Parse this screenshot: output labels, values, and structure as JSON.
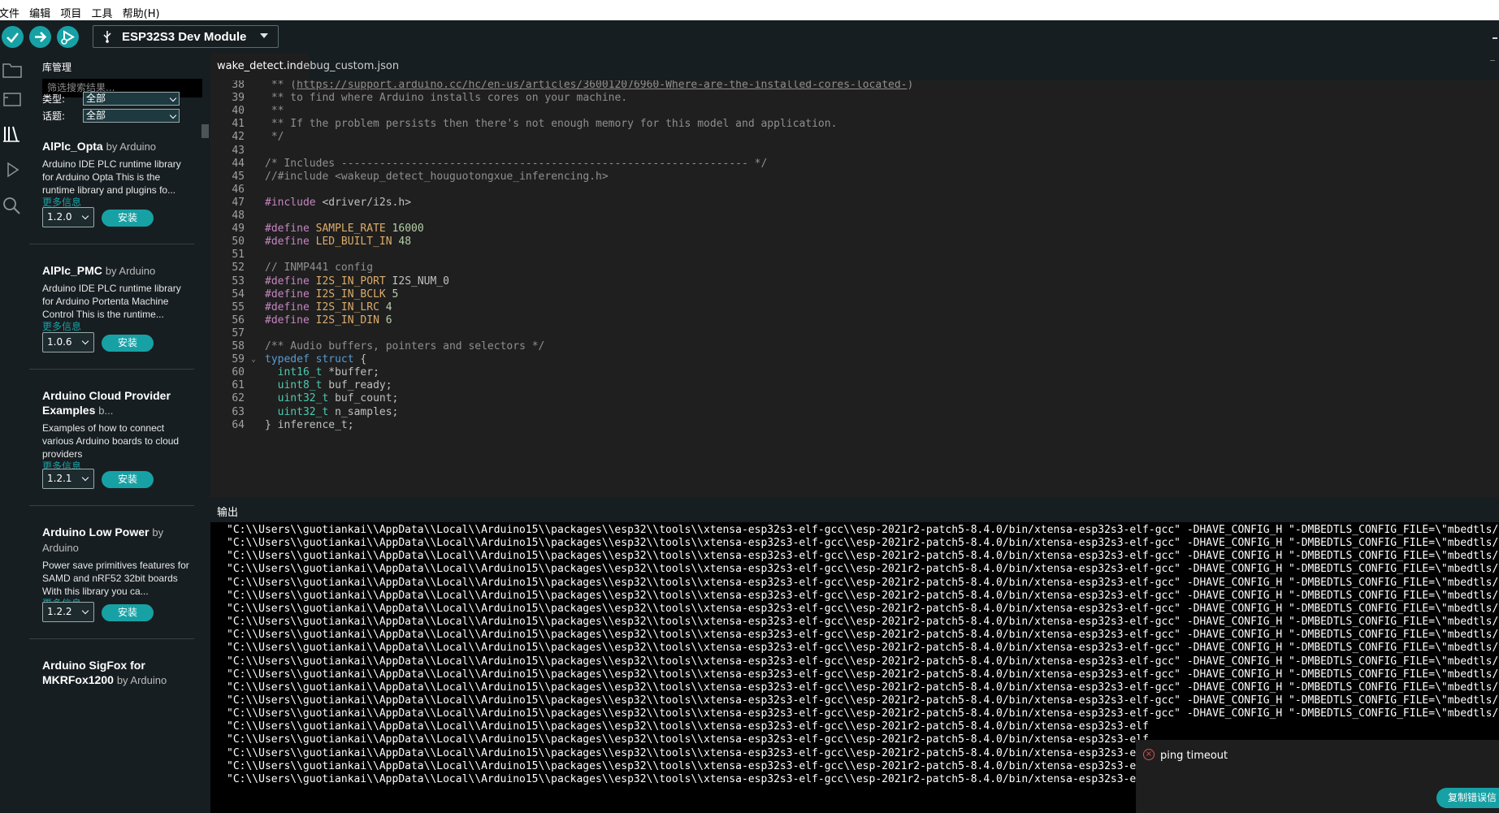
{
  "menubar": [
    "文件",
    "编辑",
    "项目",
    "工具",
    "帮助(H)"
  ],
  "toolbar": {
    "board_label": "ESP32S3 Dev Module",
    "accent": "#17a1a5"
  },
  "library_manager": {
    "title": "库管理",
    "search_placeholder": "筛选搜索结果...",
    "type_label": "类型:",
    "type_value": "全部",
    "topic_label": "话题:",
    "topic_value": "全部",
    "items": [
      {
        "name": "AlPlc_Opta",
        "by": "by Arduino",
        "desc": "Arduino IDE PLC runtime library for Arduino Opta This is the runtime library and plugins fo...",
        "more": "更多信息",
        "version": "1.2.0",
        "install": "安装"
      },
      {
        "name": "AlPlc_PMC",
        "by": "by Arduino",
        "desc": "Arduino IDE PLC runtime library for Arduino Portenta Machine Control This is the runtime...",
        "more": "更多信息",
        "version": "1.0.6",
        "install": "安装"
      },
      {
        "name": "Arduino Cloud Provider Examples",
        "by": "b...",
        "desc": "Examples of how to connect various Arduino boards to cloud providers",
        "more": "更多信息",
        "version": "1.2.1",
        "install": "安装"
      },
      {
        "name": "Arduino Low Power",
        "by": "by Arduino",
        "desc": "Power save primitives features for SAMD and nRF52 32bit boards With this library you ca...",
        "more": "更多信息",
        "version": "1.2.2",
        "install": "安装"
      },
      {
        "name": "Arduino SigFox for MKRFox1200",
        "by": "by Arduino",
        "desc": "",
        "more": "",
        "version": "",
        "install": ""
      }
    ]
  },
  "tabs": [
    "wake_detect.ino",
    "debug_custom.json"
  ],
  "editor": {
    "lines": [
      {
        "n": "38",
        "t": " ** (https://support.arduino.cc/hc/en-us/articles/360012076960-Where-are-the-installed-cores-located-)"
      },
      {
        "n": "39",
        "t": " ** to find where Arduino installs cores on your machine."
      },
      {
        "n": "40",
        "t": " **"
      },
      {
        "n": "41",
        "t": " ** If the problem persists then there's not enough memory for this model and application."
      },
      {
        "n": "42",
        "t": " */"
      },
      {
        "n": "43",
        "t": ""
      },
      {
        "n": "44",
        "t": "/* Includes ---------------------------------------------------------------- */"
      },
      {
        "n": "45",
        "t": "//#include <wakeup_detect_houguotongxue_inferencing.h>"
      },
      {
        "n": "46",
        "t": ""
      },
      {
        "n": "47",
        "t": "#include <driver/i2s.h>"
      },
      {
        "n": "48",
        "t": ""
      },
      {
        "n": "49",
        "t": "#define SAMPLE_RATE 16000"
      },
      {
        "n": "50",
        "t": "#define LED_BUILT_IN 48"
      },
      {
        "n": "51",
        "t": ""
      },
      {
        "n": "52",
        "t": "// INMP441 config"
      },
      {
        "n": "53",
        "t": "#define I2S_IN_PORT I2S_NUM_0"
      },
      {
        "n": "54",
        "t": "#define I2S_IN_BCLK 5"
      },
      {
        "n": "55",
        "t": "#define I2S_IN_LRC 4"
      },
      {
        "n": "56",
        "t": "#define I2S_IN_DIN 6"
      },
      {
        "n": "57",
        "t": ""
      },
      {
        "n": "58",
        "t": "/** Audio buffers, pointers and selectors */"
      },
      {
        "n": "59",
        "t": "typedef struct {"
      },
      {
        "n": "60",
        "t": "  int16_t *buffer;"
      },
      {
        "n": "61",
        "t": "  uint8_t buf_ready;"
      },
      {
        "n": "62",
        "t": "  uint32_t buf_count;"
      },
      {
        "n": "63",
        "t": "  uint32_t n_samples;"
      },
      {
        "n": "64",
        "t": "} inference_t;"
      }
    ]
  },
  "output": {
    "title": "输出",
    "full_line": "\"C:\\\\Users\\\\guotiankai\\\\AppData\\\\Local\\\\Arduino15\\\\packages\\\\esp32\\\\tools\\\\xtensa-esp32s3-elf-gcc\\\\esp-2021r2-patch5-8.4.0/bin/xtensa-esp32s3-elf-gcc\" -DHAVE_CONFIG_H \"-DMBEDTLS_CONFIG_FILE=\\\"mbedtls/esp",
    "short_line": "\"C:\\\\Users\\\\guotiankai\\\\AppData\\\\Local\\\\Arduino15\\\\packages\\\\esp32\\\\tools\\\\xtensa-esp32s3-elf-gcc\\\\esp-2021r2-patch5-8.4.0/bin/xtensa-esp32s3-elf",
    "line_count": 20
  },
  "notification": {
    "message": "ping timeout",
    "copy_button": "复制错误信"
  }
}
